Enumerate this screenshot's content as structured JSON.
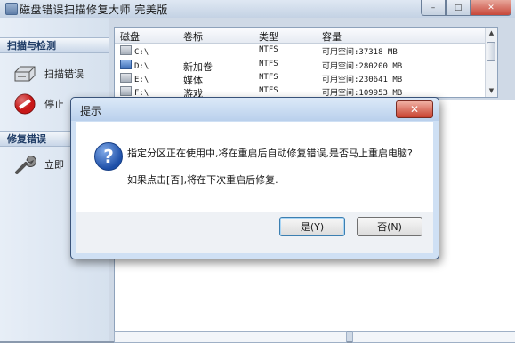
{
  "window": {
    "title": "磁盘错误扫描修复大师 完美版",
    "buttons": {
      "minimize": "–",
      "maximize": "□",
      "close": "✕"
    }
  },
  "sidebar": {
    "sections": [
      {
        "label": "扫描与检测",
        "items": [
          {
            "label": "扫描错误",
            "icon": "disk-drive-icon"
          },
          {
            "label": "停止扫描",
            "icon": "stop-icon"
          }
        ]
      },
      {
        "label": "修复错误",
        "items": [
          {
            "label": "立即修复",
            "icon": "wrench-icon"
          }
        ]
      }
    ],
    "stop_label_visible": "停止",
    "repair_label_visible": "立即"
  },
  "disk_table": {
    "columns": [
      "磁盘",
      "卷标",
      "类型",
      "容量"
    ],
    "rows": [
      {
        "drive": "C:\\",
        "label": "",
        "type": "NTFS",
        "capacity": "可用空间:37318 MB"
      },
      {
        "drive": "D:\\",
        "label": "新加卷",
        "type": "NTFS",
        "capacity": "可用空间:280200 MB"
      },
      {
        "drive": "E:\\",
        "label": "媒体",
        "type": "NTFS",
        "capacity": "可用空间:230641 MB"
      },
      {
        "drive": "F:\\",
        "label": "游戏",
        "type": "NTFS",
        "capacity": "可用空间:109953 MB"
      }
    ]
  },
  "background_text": "件",
  "dialog": {
    "title": "提示",
    "close": "✕",
    "icon": "question-icon",
    "icon_glyph": "?",
    "message_line1": "指定分区正在使用中,将在重启后自动修复错误,是否马上重启电脑?",
    "message_line2": "如果点击[否],将在下次重启后修复.",
    "yes_label": "是(Y)",
    "no_label": "否(N)"
  }
}
